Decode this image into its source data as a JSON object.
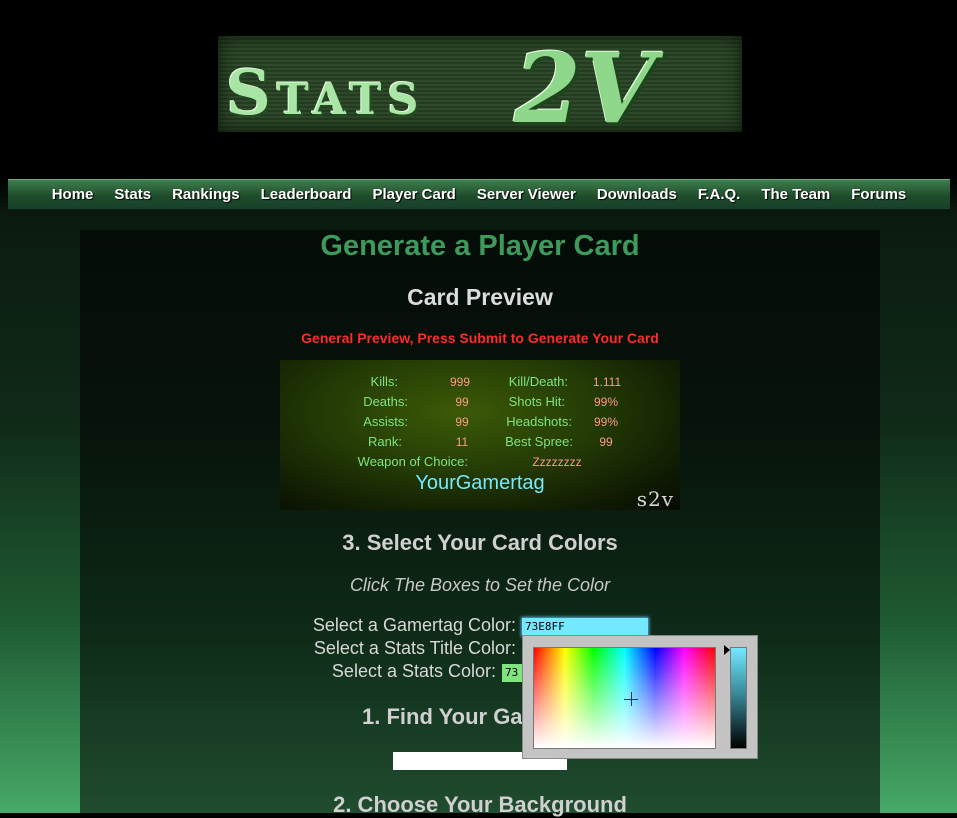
{
  "logo": {
    "text_part1": "Stats",
    "text_part2": "2V"
  },
  "nav": {
    "items": [
      "Home",
      "Stats",
      "Rankings",
      "Leaderboard",
      "Player Card",
      "Server Viewer",
      "Downloads",
      "F.A.Q.",
      "The Team",
      "Forums"
    ]
  },
  "page": {
    "title": "Generate a Player Card",
    "preview_heading": "Card Preview",
    "preview_note": "General Preview, Press Submit to Generate Your Card"
  },
  "card": {
    "kills_label": "Kills:",
    "kills_value": "999",
    "kd_label": "Kill/Death:",
    "kd_value": "1.111",
    "deaths_label": "Deaths:",
    "deaths_value": "99",
    "shots_label": "Shots Hit:",
    "shots_value": "99%",
    "assists_label": "Assists:",
    "assists_value": "99",
    "headshots_label": "Headshots:",
    "headshots_value": "99%",
    "rank_label": "Rank:",
    "rank_value": "11",
    "spree_label": "Best Spree:",
    "spree_value": "99",
    "weapon_label": "Weapon of Choice:",
    "weapon_value": "Zzzzzzzz",
    "gamertag": "YourGamertag",
    "watermark": "s2v"
  },
  "colors": {
    "heading": "3. Select Your Card Colors",
    "hint": "Click The Boxes to Set the Color",
    "gamertag_label": "Select a Gamertag Color:",
    "gamertag_value": "73E8FF",
    "stats_title_label": "Select a Stats Title Color:",
    "stats_label": "Select a Stats Color:",
    "stats_value_partial": "73",
    "gamertag_color": "#73e8ff",
    "stats_title_color": "#7fe37f",
    "stats_color": "#ff9a86"
  },
  "find": {
    "heading": "1. Find Your Ga"
  },
  "background": {
    "heading": "2. Choose Your Background"
  }
}
